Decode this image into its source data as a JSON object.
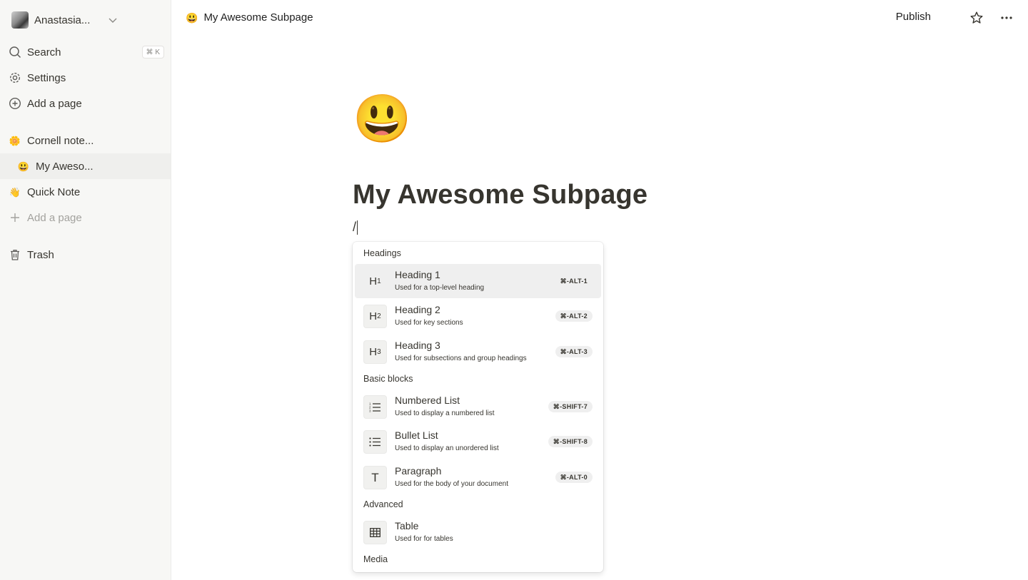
{
  "sidebar": {
    "workspace_name": "Anastasia...",
    "search_label": "Search",
    "search_shortcut": "⌘ K",
    "settings_label": "Settings",
    "add_page_label": "Add a page",
    "pages": [
      {
        "emoji": "🌼",
        "label": "Cornell note..."
      },
      {
        "emoji": "😃",
        "label": "My Aweso..."
      },
      {
        "emoji": "👋",
        "label": "Quick Note"
      }
    ],
    "add_page_sub_label": "Add a page",
    "trash_label": "Trash"
  },
  "topbar": {
    "page_emoji": "😃",
    "page_title": "My Awesome Subpage",
    "publish_label": "Publish"
  },
  "page": {
    "emoji": "😃",
    "title": "My Awesome Subpage",
    "input_text": "/"
  },
  "menu": {
    "sections": [
      "Headings",
      "Basic blocks",
      "Advanced",
      "Media"
    ],
    "items": [
      {
        "title": "Heading 1",
        "desc": "Used for a top-level heading",
        "shortcut": "⌘-ALT-1",
        "icon": "H1"
      },
      {
        "title": "Heading 2",
        "desc": "Used for key sections",
        "shortcut": "⌘-ALT-2",
        "icon": "H2"
      },
      {
        "title": "Heading 3",
        "desc": "Used for subsections and group headings",
        "shortcut": "⌘-ALT-3",
        "icon": "H3"
      },
      {
        "title": "Numbered List",
        "desc": "Used to display a numbered list",
        "shortcut": "⌘-SHIFT-7",
        "icon": "numbered-list-icon"
      },
      {
        "title": "Bullet List",
        "desc": "Used to display an unordered list",
        "shortcut": "⌘-SHIFT-8",
        "icon": "bullet-list-icon"
      },
      {
        "title": "Paragraph",
        "desc": "Used for the body of your document",
        "shortcut": "⌘-ALT-0",
        "icon": "T"
      },
      {
        "title": "Table",
        "desc": "Used for for tables",
        "shortcut": "",
        "icon": "table-icon"
      }
    ]
  }
}
